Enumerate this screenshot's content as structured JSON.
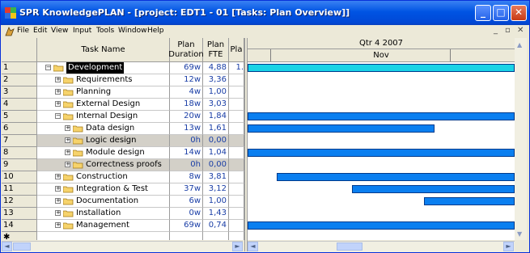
{
  "window": {
    "title": "SPR KnowledgePLAN - [project: EDT1 - 01 [Tasks: Plan Overview]]",
    "controls": {
      "minimize": "_",
      "maximize": "□",
      "close": "✕"
    }
  },
  "menubar": {
    "items": [
      "File",
      "Edit",
      "View",
      "Input",
      "Tools",
      "Window",
      "Help"
    ],
    "mdi_controls": {
      "minimize": "_",
      "restore": "▫",
      "close": "✕"
    }
  },
  "grid": {
    "columns": {
      "task_name": "Task Name",
      "plan_duration": "Plan\nDuration",
      "plan_fte": "Plan\nFTE",
      "pla": "Pla"
    },
    "rows": [
      {
        "num": "1",
        "name": "Development",
        "level": 0,
        "expanded": true,
        "duration": "69w",
        "fte": "4,88",
        "pla": "1.",
        "selected": true
      },
      {
        "num": "2",
        "name": "Requirements",
        "level": 1,
        "expanded": false,
        "duration": "12w",
        "fte": "3,36",
        "pla": ""
      },
      {
        "num": "3",
        "name": "Planning",
        "level": 1,
        "expanded": false,
        "duration": "4w",
        "fte": "1,00",
        "pla": ""
      },
      {
        "num": "4",
        "name": "External Design",
        "level": 1,
        "expanded": false,
        "duration": "18w",
        "fte": "3,03",
        "pla": ""
      },
      {
        "num": "5",
        "name": "Internal Design",
        "level": 1,
        "expanded": true,
        "duration": "20w",
        "fte": "1,84",
        "pla": ""
      },
      {
        "num": "6",
        "name": "Data design",
        "level": 2,
        "expanded": false,
        "duration": "13w",
        "fte": "1,61",
        "pla": ""
      },
      {
        "num": "7",
        "name": "Logic design",
        "level": 2,
        "expanded": false,
        "duration": "0h",
        "fte": "0,00",
        "pla": "",
        "shaded": true
      },
      {
        "num": "8",
        "name": "Module design",
        "level": 2,
        "expanded": false,
        "duration": "14w",
        "fte": "1,04",
        "pla": ""
      },
      {
        "num": "9",
        "name": "Correctness proofs",
        "level": 2,
        "expanded": false,
        "duration": "0h",
        "fte": "0,00",
        "pla": "",
        "shaded": true
      },
      {
        "num": "10",
        "name": "Construction",
        "level": 1,
        "expanded": false,
        "duration": "8w",
        "fte": "3,81",
        "pla": ""
      },
      {
        "num": "11",
        "name": "Integration & Test",
        "level": 1,
        "expanded": false,
        "duration": "37w",
        "fte": "3,12",
        "pla": ""
      },
      {
        "num": "12",
        "name": "Documentation",
        "level": 1,
        "expanded": false,
        "duration": "6w",
        "fte": "1,00",
        "pla": ""
      },
      {
        "num": "13",
        "name": "Installation",
        "level": 1,
        "expanded": false,
        "duration": "0w",
        "fte": "1,43",
        "pla": ""
      },
      {
        "num": "14",
        "name": "Management",
        "level": 1,
        "expanded": false,
        "duration": "69w",
        "fte": "0,74",
        "pla": ""
      }
    ],
    "new_row_marker": "✱"
  },
  "gantt": {
    "quarter_label": "Qtr 4 2007",
    "month_label": "Nov",
    "bar_color": "#0a7ff0",
    "summary_bar_color": "#19d3e6",
    "bars": [
      {
        "row": 1,
        "start": 0.0,
        "end": 1.0,
        "summary": true
      },
      {
        "row": 5,
        "start": 0.0,
        "end": 1.0
      },
      {
        "row": 6,
        "start": 0.0,
        "end": 0.7
      },
      {
        "row": 8,
        "start": 0.0,
        "end": 1.0
      },
      {
        "row": 10,
        "start": 0.11,
        "end": 1.0
      },
      {
        "row": 11,
        "start": 0.39,
        "end": 1.0
      },
      {
        "row": 12,
        "start": 0.66,
        "end": 1.0
      },
      {
        "row": 14,
        "start": 0.0,
        "end": 1.0
      }
    ]
  },
  "scrollbars": {
    "left": "◄",
    "right": "►"
  }
}
